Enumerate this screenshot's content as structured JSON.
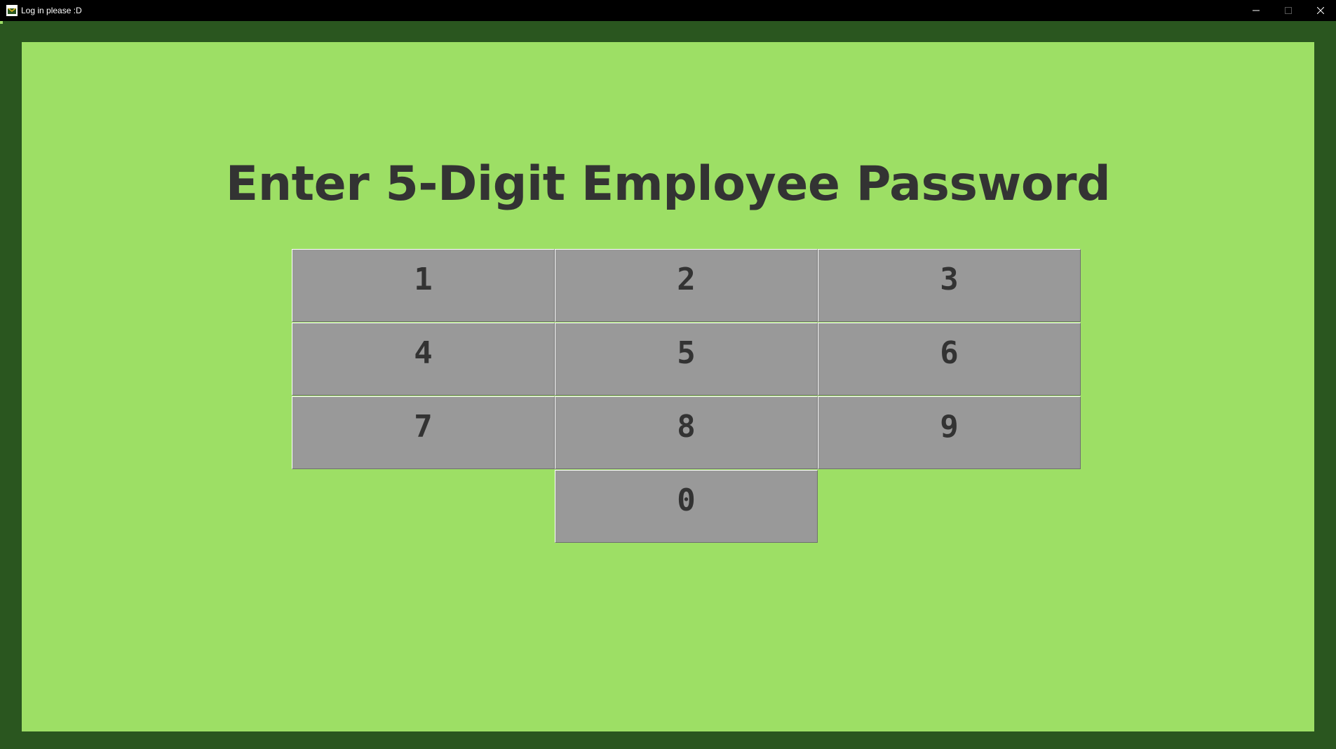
{
  "window": {
    "title": "Log in please :D",
    "icon": "app-logo-icon",
    "controls": [
      "minimize-icon",
      "maximize-icon",
      "close-icon"
    ]
  },
  "main": {
    "heading": "Enter 5-Digit Employee Password",
    "keypad": [
      "1",
      "2",
      "3",
      "4",
      "5",
      "6",
      "7",
      "8",
      "9",
      "0"
    ]
  },
  "colors": {
    "background": "#9ddf65",
    "frame": "#2a561f",
    "key": "#999999",
    "text": "#333333"
  }
}
